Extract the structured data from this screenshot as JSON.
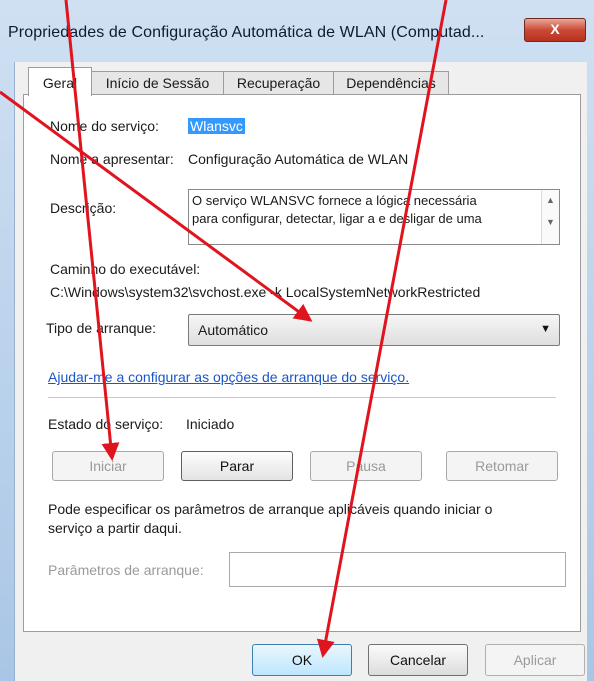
{
  "window": {
    "title": "Propriedades de Configuração Automática de WLAN (Computad...",
    "close_glyph": "X",
    "accent_color": "#cc4a35"
  },
  "tabs": [
    {
      "label": "Geral",
      "active": true
    },
    {
      "label": "Início de Sessão",
      "active": false
    },
    {
      "label": "Recuperação",
      "active": false
    },
    {
      "label": "Dependências",
      "active": false
    }
  ],
  "general": {
    "service_name_label": "Nome do serviço:",
    "service_name_value": "Wlansvc",
    "display_name_label": "Nome a apresentar:",
    "display_name_value": "Configuração Automática de WLAN",
    "description_label": "Descrição:",
    "description_value": "O serviço WLANSVC fornece a lógica necessária\npara configurar, detectar, ligar a e desligar de uma",
    "exe_path_label": "Caminho do executável:",
    "exe_path_value": "C:\\Windows\\system32\\svchost.exe -k LocalSystemNetworkRestricted",
    "startup_type_label": "Tipo de arranque:",
    "startup_type_value": "Automático",
    "help_link": "Ajudar-me a configurar as opções de arranque do serviço.",
    "service_status_label": "Estado do serviço:",
    "service_status_value": "Iniciado",
    "buttons": {
      "start": "Iniciar",
      "stop": "Parar",
      "pause": "Pausa",
      "resume": "Retomar"
    },
    "params_hint": "Pode especificar os parâmetros de arranque aplicáveis quando iniciar o\nserviço a partir daqui.",
    "params_label": "Parâmetros de arranque:",
    "params_value": ""
  },
  "footer": {
    "ok": "OK",
    "cancel": "Cancelar",
    "apply": "Aplicar"
  },
  "annotation_color": "#e0141e"
}
